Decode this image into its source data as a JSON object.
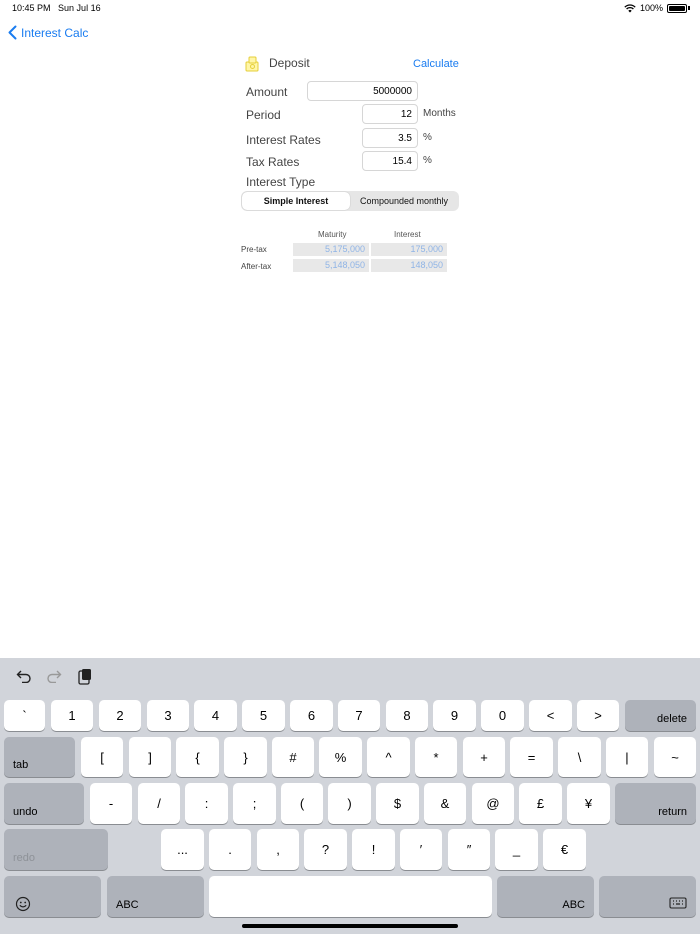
{
  "status": {
    "time": "10:45 PM",
    "date": "Sun Jul 16",
    "battery": "100%"
  },
  "nav": {
    "back_label": "Interest Calc"
  },
  "form": {
    "title": "Deposit",
    "calculate_label": "Calculate",
    "amount": {
      "label": "Amount",
      "value": "5000000"
    },
    "period": {
      "label": "Period",
      "value": "12",
      "unit": "Months"
    },
    "interest_rate": {
      "label": "Interest Rates",
      "value": "3.5",
      "unit": "%"
    },
    "tax_rate": {
      "label": "Tax Rates",
      "value": "15.4",
      "unit": "%"
    },
    "interest_type_label": "Interest Type",
    "interest_type_options": [
      "Simple Interest",
      "Compounded monthly"
    ],
    "interest_type_selected": "Simple Interest"
  },
  "results": {
    "col_maturity": "Maturity",
    "col_interest": "Interest",
    "rows": [
      {
        "label": "Pre-tax",
        "maturity": "5,175,000",
        "interest": "175,000"
      },
      {
        "label": "After-tax",
        "maturity": "5,148,050",
        "interest": "148,050"
      }
    ]
  },
  "keyboard": {
    "row1": [
      "`",
      "1",
      "2",
      "3",
      "4",
      "5",
      "6",
      "7",
      "8",
      "9",
      "0",
      "<",
      ">"
    ],
    "row1_end": "delete",
    "row2_start": "tab",
    "row2": [
      "[",
      "]",
      "{",
      "}",
      "#",
      "%",
      "^",
      "*",
      "+",
      "=",
      "\\",
      "|",
      "~"
    ],
    "row3_start": "undo",
    "row3": [
      "-",
      "/",
      ":",
      ";",
      "(",
      ")",
      "$",
      "&",
      "@",
      "£",
      "¥"
    ],
    "row3_end": "return",
    "row4_start": "redo",
    "row4": [
      "...",
      ".",
      ",",
      "?",
      "!",
      "′",
      "″",
      "_",
      "€"
    ],
    "row5_abc_left": "ABC",
    "row5_abc_right": "ABC"
  }
}
